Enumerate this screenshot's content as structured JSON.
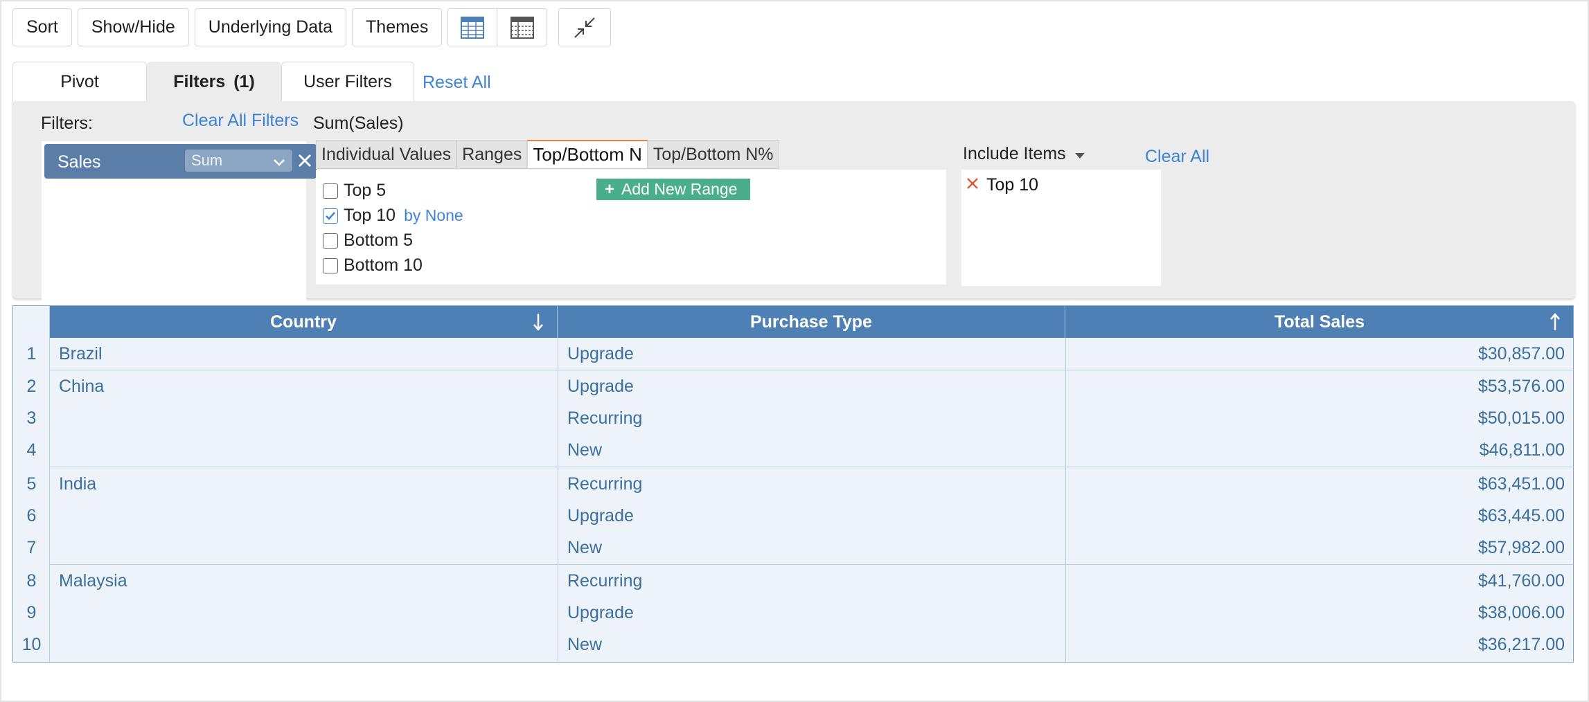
{
  "toolbar": {
    "buttons": [
      "Sort",
      "Show/Hide",
      "Underlying Data",
      "Themes"
    ],
    "icons": [
      "table-view-icon",
      "layout-view-icon",
      "collapse-icon"
    ]
  },
  "tabs": {
    "pivot": "Pivot",
    "filters": "Filters",
    "filters_count": "(1)",
    "user_filters": "User Filters",
    "reset_all": "Reset All"
  },
  "filter_panel": {
    "filters_label": "Filters:",
    "clear_all_filters": "Clear All Filters",
    "field": {
      "name": "Sales",
      "aggregation": "Sum"
    },
    "measure_title": "Sum(Sales)",
    "sub_tabs": [
      "Individual Values",
      "Ranges",
      "Top/Bottom N",
      "Top/Bottom N%"
    ],
    "active_sub_tab": "Top/Bottom N",
    "options": [
      {
        "label": "Top 5",
        "checked": false,
        "suffix": ""
      },
      {
        "label": "Top 10",
        "checked": true,
        "suffix": "by None"
      },
      {
        "label": "Bottom 5",
        "checked": false,
        "suffix": ""
      },
      {
        "label": "Bottom 10",
        "checked": false,
        "suffix": ""
      }
    ],
    "add_new_range": "Add New Range",
    "include_items": "Include Items",
    "clear_all": "Clear All",
    "included": [
      "Top 10"
    ]
  },
  "table": {
    "columns": [
      "Country",
      "Purchase Type",
      "Total Sales"
    ],
    "sort": {
      "Country": "descending",
      "Total Sales": "ascending"
    },
    "rows": [
      {
        "n": "1",
        "country": "Brazil",
        "type": "Upgrade",
        "sales": "$30,857.00"
      },
      {
        "n": "2",
        "country": "China",
        "type": "Upgrade",
        "sales": "$53,576.00"
      },
      {
        "n": "3",
        "country": "",
        "type": "Recurring",
        "sales": "$50,015.00"
      },
      {
        "n": "4",
        "country": "",
        "type": "New",
        "sales": "$46,811.00"
      },
      {
        "n": "5",
        "country": "India",
        "type": "Recurring",
        "sales": "$63,451.00"
      },
      {
        "n": "6",
        "country": "",
        "type": "Upgrade",
        "sales": "$63,445.00"
      },
      {
        "n": "7",
        "country": "",
        "type": "New",
        "sales": "$57,982.00"
      },
      {
        "n": "8",
        "country": "Malaysia",
        "type": "Recurring",
        "sales": "$41,760.00"
      },
      {
        "n": "9",
        "country": "",
        "type": "Upgrade",
        "sales": "$38,006.00"
      },
      {
        "n": "10",
        "country": "",
        "type": "New",
        "sales": "$36,217.00"
      }
    ]
  },
  "colors": {
    "accent": "#3e84d6",
    "header": "#4f80b5",
    "add_range": "#4aae8c",
    "active_tab_line": "#e2873d",
    "remove_x": "#e05a3a"
  }
}
